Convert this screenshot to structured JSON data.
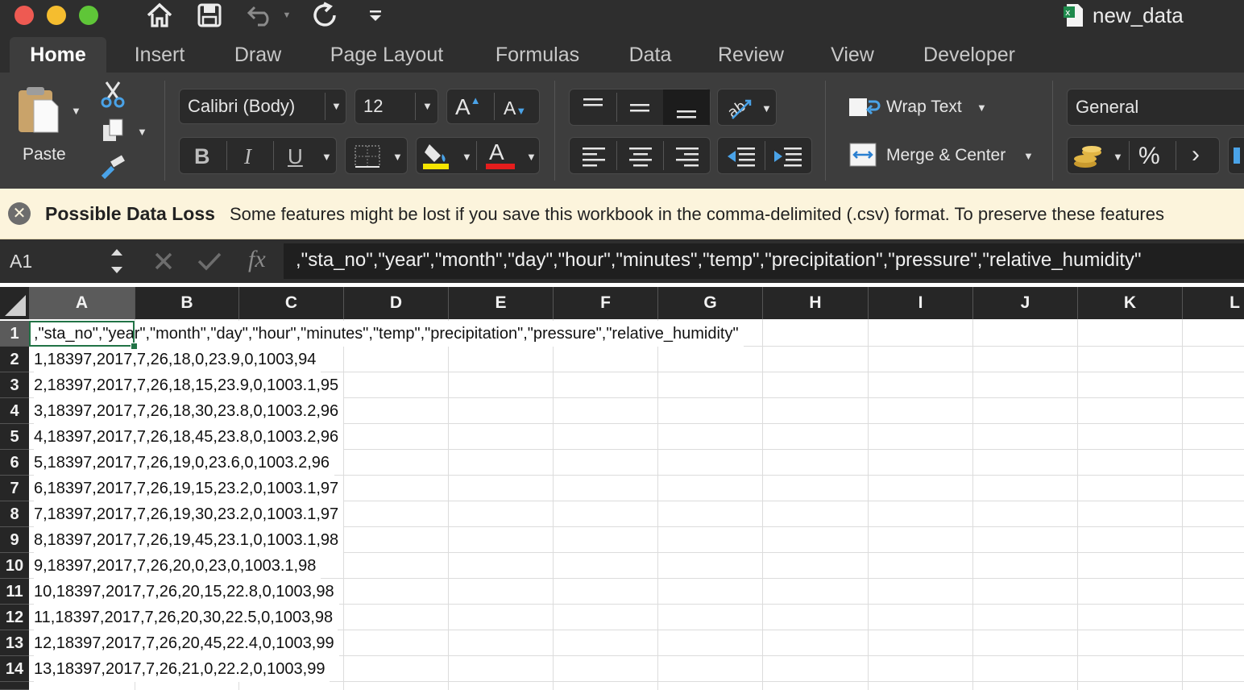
{
  "window": {
    "title": "new_data",
    "traffic_lights": {
      "close": "#ee5a52",
      "minimize": "#f5bd2f",
      "zoom": "#5fc638"
    }
  },
  "quick_access": [
    "home-icon",
    "save-icon",
    "undo-icon",
    "redo-icon",
    "customize-icon"
  ],
  "tabs": [
    {
      "label": "Home",
      "active": true
    },
    {
      "label": "Insert"
    },
    {
      "label": "Draw"
    },
    {
      "label": "Page Layout"
    },
    {
      "label": "Formulas"
    },
    {
      "label": "Data"
    },
    {
      "label": "Review"
    },
    {
      "label": "View"
    },
    {
      "label": "Developer"
    }
  ],
  "ribbon": {
    "paste_label": "Paste",
    "font_name": "Calibri (Body)",
    "font_size": "12",
    "bold": "B",
    "italic": "I",
    "underline": "U",
    "grow_font": "A",
    "shrink_font": "A",
    "font_color_letter": "A",
    "wrap_text": "Wrap Text",
    "merge_center": "Merge & Center",
    "number_format": "General",
    "percent": "%",
    "comma": "›",
    "highlight_color": "#f5e500",
    "font_color": "#e51d1d"
  },
  "banner": {
    "title": "Possible Data Loss",
    "message": "Some features might be lost if you save this workbook in the comma-delimited (.csv) format. To preserve these features"
  },
  "formula_bar": {
    "name_box": "A1",
    "fx": "fx",
    "content": ",\"sta_no\",\"year\",\"month\",\"day\",\"hour\",\"minutes\",\"temp\",\"precipitation\",\"pressure\",\"relative_humidity\""
  },
  "columns": [
    "A",
    "B",
    "C",
    "D",
    "E",
    "F",
    "G",
    "H",
    "I",
    "J",
    "K",
    "L"
  ],
  "rows": [
    {
      "n": "1",
      "a": ",\"sta_no\",\"year\",\"month\",\"day\",\"hour\",\"minutes\",\"temp\",\"precipitation\",\"pressure\",\"relative_humidity\""
    },
    {
      "n": "2",
      "a": "1,18397,2017,7,26,18,0,23.9,0,1003,94"
    },
    {
      "n": "3",
      "a": "2,18397,2017,7,26,18,15,23.9,0,1003.1,95"
    },
    {
      "n": "4",
      "a": "3,18397,2017,7,26,18,30,23.8,0,1003.2,96"
    },
    {
      "n": "5",
      "a": "4,18397,2017,7,26,18,45,23.8,0,1003.2,96"
    },
    {
      "n": "6",
      "a": "5,18397,2017,7,26,19,0,23.6,0,1003.2,96"
    },
    {
      "n": "7",
      "a": "6,18397,2017,7,26,19,15,23.2,0,1003.1,97"
    },
    {
      "n": "8",
      "a": "7,18397,2017,7,26,19,30,23.2,0,1003.1,97"
    },
    {
      "n": "9",
      "a": "8,18397,2017,7,26,19,45,23.1,0,1003.1,98"
    },
    {
      "n": "10",
      "a": "9,18397,2017,7,26,20,0,23,0,1003.1,98"
    },
    {
      "n": "11",
      "a": "10,18397,2017,7,26,20,15,22.8,0,1003,98"
    },
    {
      "n": "12",
      "a": "11,18397,2017,7,26,20,30,22.5,0,1003,98"
    },
    {
      "n": "13",
      "a": "12,18397,2017,7,26,20,45,22.4,0,1003,99"
    },
    {
      "n": "14",
      "a": "13,18397,2017,7,26,21,0,22.2,0,1003,99"
    }
  ]
}
